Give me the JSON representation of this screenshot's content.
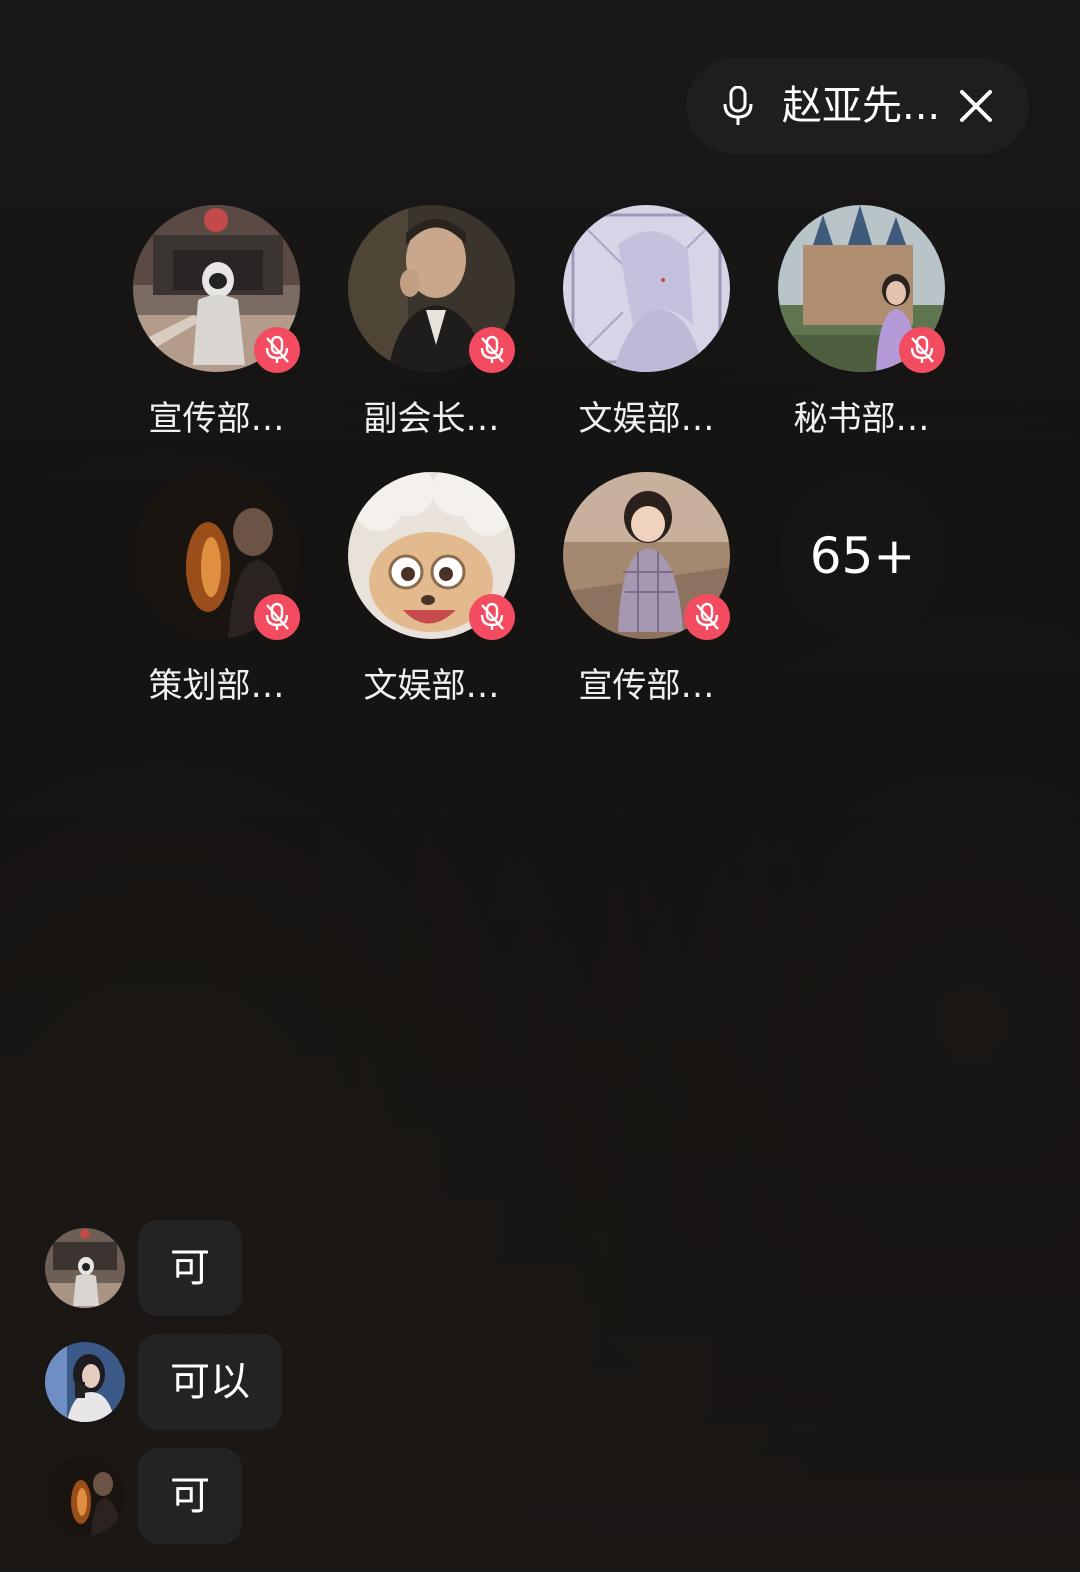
{
  "voice_pill": {
    "title": "赵亚先...",
    "mic_icon": "microphone-icon",
    "close_icon": "close-icon"
  },
  "participants": [
    {
      "name": "宣传部…",
      "muted": true,
      "avatar": "astronaut-street-photo"
    },
    {
      "name": "副会长…",
      "muted": true,
      "avatar": "man-smoking-photo"
    },
    {
      "name": "文娱部…",
      "muted": false,
      "avatar": "anime-drawing"
    },
    {
      "name": "秘书部…",
      "muted": true,
      "avatar": "castle-girl-photo"
    },
    {
      "name": "策划部…",
      "muted": true,
      "avatar": "dark-portrait-photo"
    },
    {
      "name": "文娱部…",
      "muted": true,
      "avatar": "cartoon-sheep"
    },
    {
      "name": "宣传部…",
      "muted": true,
      "avatar": "child-in-coat-photo"
    }
  ],
  "more_count": "65+",
  "chat": [
    {
      "text": "可",
      "avatar": "astronaut-street-photo"
    },
    {
      "text": "可以",
      "avatar": "girl-mirror-selfie"
    },
    {
      "text": "可",
      "avatar": "dark-portrait-photo"
    }
  ],
  "colors": {
    "mute_badge": "#f34b5f",
    "pill_bg": "#1e1e1e",
    "bubble_bg": "#232323"
  }
}
